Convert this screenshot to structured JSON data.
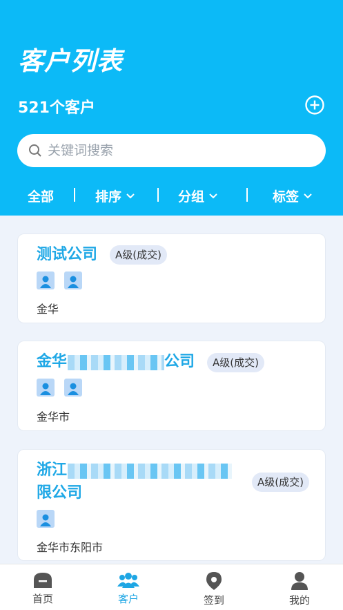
{
  "header": {
    "title": "客户列表",
    "count_label": "521个客户",
    "search_placeholder": "关键词搜索"
  },
  "filters": [
    {
      "label": "全部"
    },
    {
      "label": "排序"
    },
    {
      "label": "分组"
    },
    {
      "label": "标签"
    }
  ],
  "customers": [
    {
      "name": "测试公司",
      "name_line2": "",
      "tag": "A级(成交)",
      "location": "金华"
    },
    {
      "name": "金华",
      "name_suffix": "公司",
      "tag": "A级(成交)",
      "location": "金华市"
    },
    {
      "name": "浙江",
      "name_line2": "限公司",
      "tag": "A级(成交)",
      "location": "金华市东阳市"
    }
  ],
  "tabs": [
    {
      "label": "首页"
    },
    {
      "label": "客户"
    },
    {
      "label": "签到"
    },
    {
      "label": "我的"
    }
  ],
  "colors": {
    "header_bg": "#0cbaf7",
    "accent": "#1fa8e6",
    "page_bg": "#eef3fb"
  }
}
